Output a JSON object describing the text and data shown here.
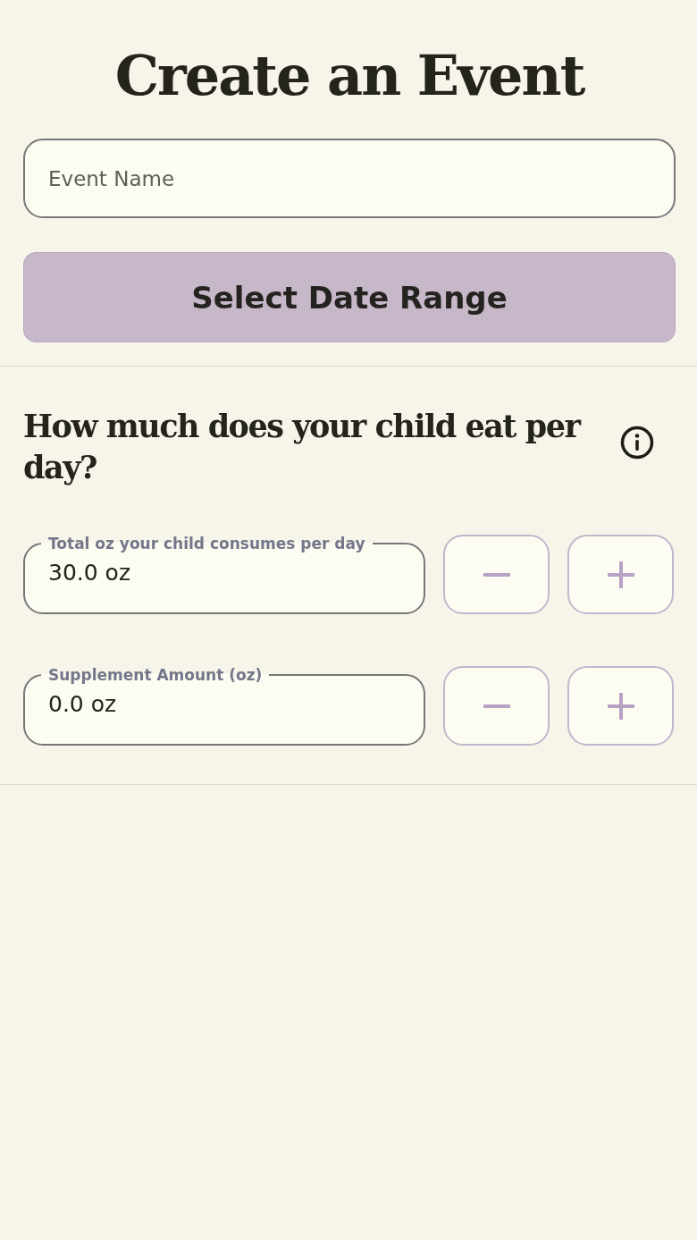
{
  "title": "Create an Event",
  "event_name": {
    "placeholder": "Event Name"
  },
  "date_button": {
    "label": "Select Date Range"
  },
  "question": {
    "text": "How much does your child eat per day?"
  },
  "amounts": [
    {
      "label": "Total oz your child consumes per day",
      "value": "30.0 oz"
    },
    {
      "label": "Supplement Amount (oz)",
      "value": "0.0 oz"
    }
  ]
}
